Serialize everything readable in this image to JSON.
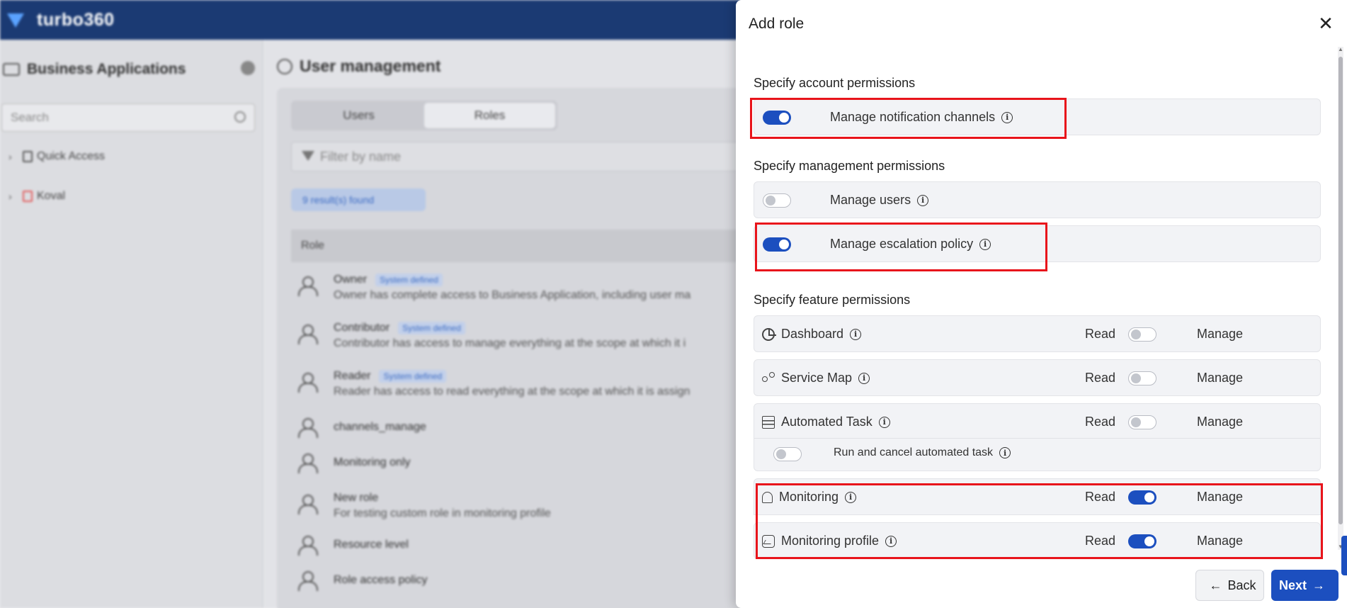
{
  "app": {
    "logo_text": "turbo360"
  },
  "sidebar": {
    "title": "Business Applications",
    "search_placeholder": "Search",
    "items": [
      {
        "label": "Quick Access"
      },
      {
        "label": "Koval"
      }
    ]
  },
  "main": {
    "title": "User management",
    "tabs": [
      "Users",
      "Roles"
    ],
    "filter_placeholder": "Filter by name",
    "results_badge": "9 result(s) found",
    "table_header": "Role",
    "rows": [
      {
        "name": "Owner",
        "tag": "System defined",
        "desc": "Owner has complete access to Business Application, including user ma"
      },
      {
        "name": "Contributor",
        "tag": "System defined",
        "desc": "Contributor has access to manage everything at the scope at which it i"
      },
      {
        "name": "Reader",
        "tag": "System defined",
        "desc": "Reader has access to read everything at the scope at which it is assign"
      },
      {
        "name": "channels_manage",
        "tag": "",
        "desc": ""
      },
      {
        "name": "Monitoring only",
        "tag": "",
        "desc": ""
      },
      {
        "name": "New role",
        "tag": "",
        "desc": "For testing custom role in monitoring profile"
      },
      {
        "name": "Resource level",
        "tag": "",
        "desc": ""
      },
      {
        "name": "Role access policy",
        "tag": "",
        "desc": ""
      }
    ]
  },
  "dialog": {
    "title": "Add role",
    "account_section": "Specify account permissions",
    "notification_label": "Manage notification channels",
    "management_section": "Specify management permissions",
    "manage_users_label": "Manage users",
    "escalation_label": "Manage escalation policy",
    "feature_section": "Specify feature permissions",
    "features": [
      {
        "label": "Dashboard",
        "read": "Read",
        "manage": "Manage",
        "read_on": false,
        "icon": "pie-chart-icon"
      },
      {
        "label": "Service Map",
        "read": "Read",
        "manage": "Manage",
        "read_on": false,
        "icon": "network-icon"
      },
      {
        "label": "Automated Task",
        "read": "Read",
        "manage": "Manage",
        "read_on": false,
        "icon": "server-icon"
      },
      {
        "label": "Monitoring",
        "read": "Read",
        "manage": "Manage",
        "read_on": true,
        "icon": "bell-icon"
      },
      {
        "label": "Monitoring profile",
        "read": "Read",
        "manage": "Manage",
        "read_on": true,
        "icon": "chart-line-icon"
      }
    ],
    "subtask_label": "Run and cancel automated task",
    "back_label": "Back",
    "next_label": "Next",
    "highlight_color": "#e8141b",
    "accent_color": "#1c4fbf"
  }
}
